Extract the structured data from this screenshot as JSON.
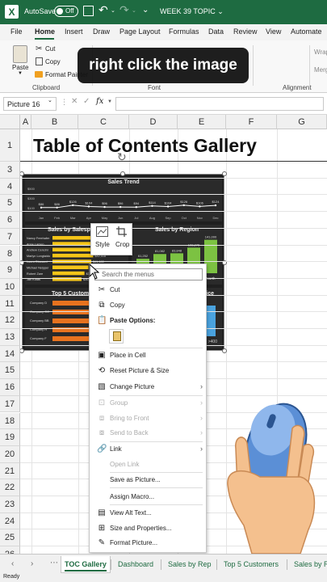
{
  "titlebar": {
    "logo": "X",
    "autosave_label": "AutoSave",
    "autosave_state": "Off",
    "doc_title": "WEEK 39 TOPIC ⌄",
    "icons": [
      "excel-logo",
      "save-icon",
      "undo-icon",
      "redo-icon",
      "more-icon"
    ]
  },
  "menu": {
    "tabs": [
      "File",
      "Home",
      "Insert",
      "Draw",
      "Page Layout",
      "Formulas",
      "Data",
      "Review",
      "View",
      "Automate"
    ],
    "active": "Home"
  },
  "ribbon": {
    "paste": "Paste",
    "cut": "Cut",
    "copy": "Copy",
    "format_painter": "Format Painter",
    "clipboard_group": "Clipboard",
    "font_group": "Font",
    "alignment_group": "Alignment",
    "wrap": "Wrap",
    "merge": "Merg"
  },
  "caption": "right click the image",
  "formula_bar": {
    "name_box": "Picture 16",
    "fx": "fx",
    "value": ""
  },
  "columns": [
    "A",
    "B",
    "C",
    "D",
    "E",
    "F",
    "G"
  ],
  "rows": [
    "1",
    "3",
    "4",
    "5",
    "6",
    "7",
    "8",
    "9",
    "10",
    "11",
    "12",
    "13",
    "14",
    "15",
    "16",
    "17",
    "18",
    "19",
    "20",
    "21",
    "22",
    "23",
    "24",
    "25",
    "26",
    "27"
  ],
  "sheet_title": "Table of Contents Gallery",
  "picture": {
    "trend": {
      "title": "Sales Trend",
      "months": [
        "Jan",
        "Feb",
        "Mar",
        "Apr",
        "May",
        "Jun",
        "Jul",
        "Aug",
        "Sep",
        "Oct",
        "Nov",
        "Dec"
      ],
      "values": [
        86,
        86,
        126,
        104,
        96,
        96,
        94,
        114,
        104,
        126,
        106,
        124
      ],
      "labels": [
        "$86",
        "$86",
        "$126",
        "$104",
        "$96",
        "$96",
        "$94",
        "$114",
        "$104",
        "$126",
        "$106",
        "$124"
      ],
      "y_ticks": [
        "$500",
        "$300",
        "$100"
      ]
    },
    "salesperson": {
      "title": "Sales by Salesperson",
      "names": [
        "Nancy Freehafer",
        "Anne Larsen",
        "Andrew Cencini",
        "Marlyn Longtaido",
        "Laura Giussani",
        "Michael Neipper",
        "Robert Zare",
        "Jan Kotas"
      ],
      "values": [
        49,
        46,
        44,
        42,
        40,
        37,
        33,
        30
      ],
      "labels": [
        "",
        "",
        "",
        "$42,518",
        "$41,180",
        "$37,408",
        "$31,321",
        "$30,095"
      ],
      "accent": "#f5c518"
    },
    "region": {
      "title": "Sales by Region",
      "values": [
        61,
        81,
        84,
        108,
        141
      ],
      "labels": [
        "61,252",
        "81,082",
        "83,848",
        "108,276",
        "141,000"
      ],
      "north_label": "North",
      "accent": "#7cc242"
    },
    "customers": {
      "title": "Top 5 Customers",
      "names": [
        "Company D",
        "Company CC",
        "Company BB",
        "Company H",
        "Company F"
      ],
      "accent": "#e8731f"
    },
    "price": {
      "title": "...ice",
      "tail": ">400"
    }
  },
  "minitoolbar": {
    "style": "Style",
    "crop": "Crop"
  },
  "context_menu": {
    "search_placeholder": "Search the menus",
    "cut": "Cut",
    "copy": "Copy",
    "paste_options": "Paste Options:",
    "place_in_cell": "Place in Cell",
    "reset_picture": "Reset Picture & Size",
    "change_picture": "Change Picture",
    "group": "Group",
    "bring_to_front": "Bring to Front",
    "send_to_back": "Send to Back",
    "link": "Link",
    "open_link": "Open Link",
    "save_as_picture": "Save as Picture...",
    "assign_macro": "Assign Macro...",
    "view_alt_text": "View Alt Text...",
    "size_properties": "Size and Properties...",
    "format_picture": "Format Picture..."
  },
  "sheet_tabs": {
    "tabs": [
      "TOC Gallery",
      "Dashboard",
      "Sales by Rep",
      "Top 5 Customers",
      "Sales by R"
    ],
    "active": "TOC Gallery"
  },
  "status": "Ready"
}
